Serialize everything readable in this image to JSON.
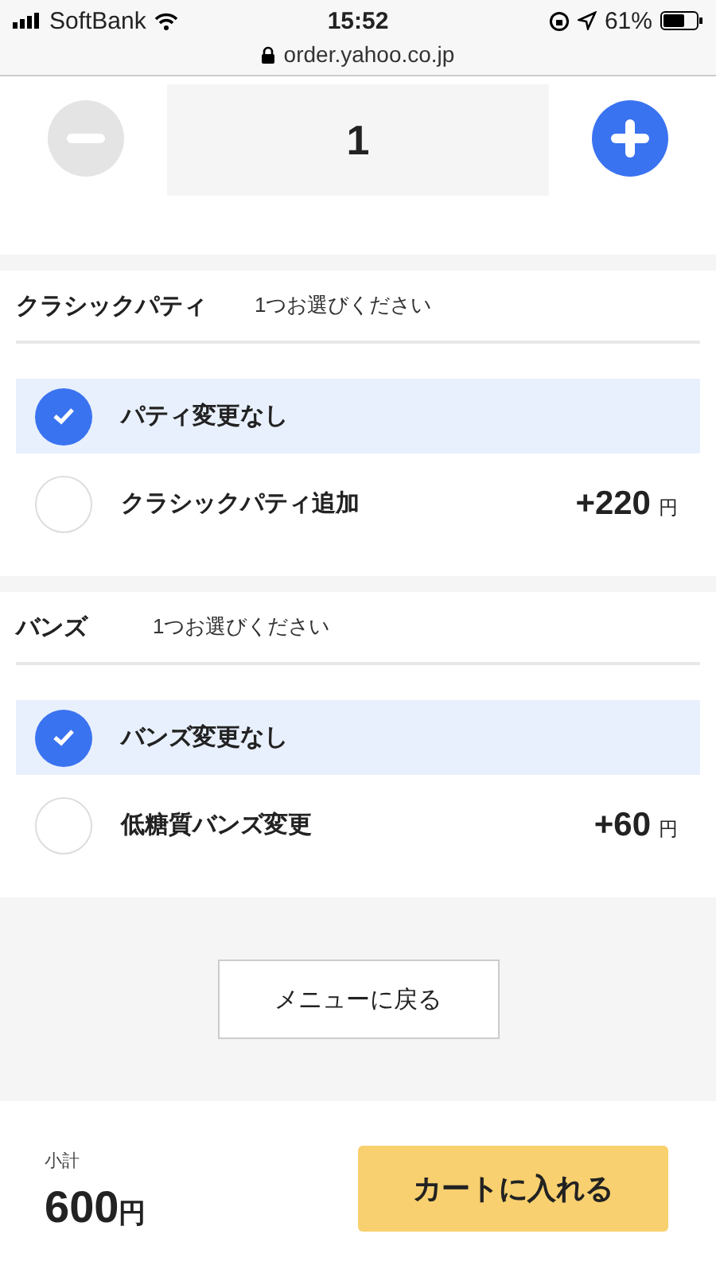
{
  "status_bar": {
    "carrier": "SoftBank",
    "time": "15:52",
    "battery": "61%"
  },
  "address_bar": {
    "url": "order.yahoo.co.jp"
  },
  "quantity": {
    "value": "1",
    "minus_disabled": true
  },
  "sections": [
    {
      "title": "クラシックパティ",
      "hint": "1つお選びください",
      "options": [
        {
          "label": "パティ変更なし",
          "selected": true
        },
        {
          "label": "クラシックパティ追加",
          "selected": false,
          "price": "+220",
          "unit": "円"
        }
      ]
    },
    {
      "title": "バンズ",
      "hint": "1つお選びください",
      "options": [
        {
          "label": "バンズ変更なし",
          "selected": true
        },
        {
          "label": "低糖質バンズ変更",
          "selected": false,
          "price": "+60",
          "unit": "円"
        }
      ]
    }
  ],
  "back_button": "メニューに戻る",
  "footer": {
    "subtotal_label": "小計",
    "subtotal": "600",
    "unit": "円",
    "cart_button": "カートに入れる"
  }
}
